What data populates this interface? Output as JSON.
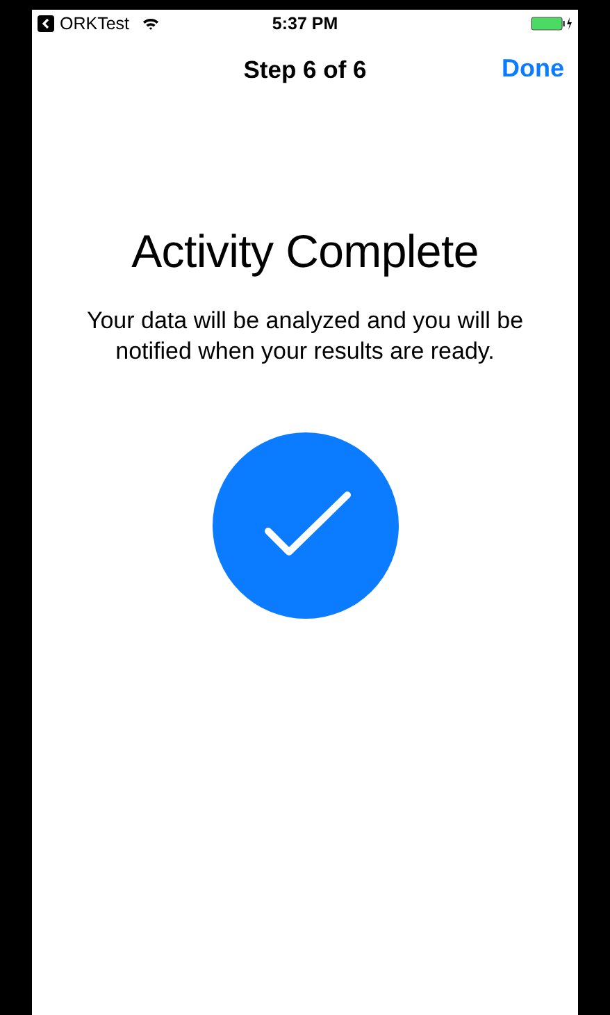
{
  "status_bar": {
    "back_app": "ORKTest",
    "time": "5:37 PM"
  },
  "nav_bar": {
    "title": "Step 6 of 6",
    "done_button": "Done"
  },
  "content": {
    "title": "Activity Complete",
    "message": "Your data will be analyzed and you will be notified when your results are ready."
  }
}
